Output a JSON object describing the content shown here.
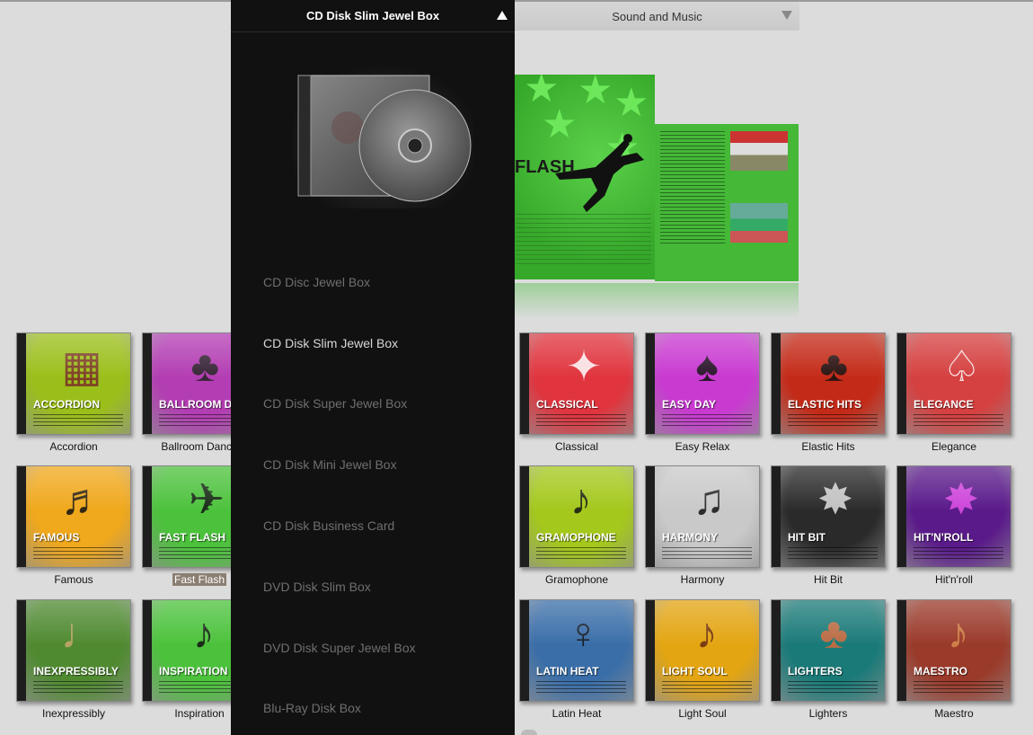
{
  "product_select": {
    "selected": "CD Disk Slim Jewel Box"
  },
  "category_select": {
    "selected": "Sound and Music"
  },
  "menu": [
    "CD Disc Jewel Box",
    "CD Disk Slim Jewel Box",
    "CD Disk Super Jewel Box",
    "CD Disk Mini Jewel Box",
    "CD Disk Business Card",
    "DVD Disk Slim Box",
    "DVD Disk Super Jewel Box",
    "Blu-Ray Disk Box"
  ],
  "menu_active_index": 1,
  "preview": {
    "front_title": "FLASH"
  },
  "templates": [
    {
      "name": "Accordion",
      "cover_title": "ACCORDION",
      "bg": "#9bbf1a",
      "accent": "#7a2a2a",
      "icon": "accordion-icon"
    },
    {
      "name": "Ballroom Dance",
      "cover_title": "BALLROOM DANCE",
      "bg": "#b33db3",
      "accent": "#222",
      "icon": "dancers-icon"
    },
    {
      "name": "Classical",
      "cover_title": "CLASSICAL",
      "bg": "#e0343e",
      "accent": "#fff",
      "icon": "ballerina-icon"
    },
    {
      "name": "Easy Relax",
      "cover_title": "EASY DAY",
      "bg": "#c93ad1",
      "accent": "#111",
      "icon": "yoga-icon"
    },
    {
      "name": "Elastic Hits",
      "cover_title": "ELASTIC HITS",
      "bg": "#c42a18",
      "accent": "#111",
      "icon": "dancers-icon"
    },
    {
      "name": "Elegance",
      "cover_title": "ELEGANCE",
      "bg": "#d54040",
      "accent": "#fff",
      "icon": "tango-icon"
    },
    {
      "name": "Famous",
      "cover_title": "FAMOUS",
      "bg": "#f0a81c",
      "accent": "#111",
      "icon": "piano-icon"
    },
    {
      "name": "Fast Flash",
      "cover_title": "FAST FLASH",
      "bg": "#4cc23c",
      "accent": "#111",
      "icon": "dancer-icon"
    },
    {
      "name": "Gramophone",
      "cover_title": "GRAMOPHONE",
      "bg": "#a4c81c",
      "accent": "#111",
      "icon": "gramophone-icon"
    },
    {
      "name": "Harmony",
      "cover_title": "HARMONY",
      "bg": "#c9c9c9",
      "accent": "#111",
      "icon": "notes-icon"
    },
    {
      "name": "Hit Bit",
      "cover_title": "HIT BIT",
      "bg": "#2a2a2a",
      "accent": "#ddd",
      "icon": "breakdancer-icon"
    },
    {
      "name": "Hit'n'roll",
      "cover_title": "HIT'N'ROLL",
      "bg": "#5a1a8a",
      "accent": "#e24de8",
      "icon": "breakdancer-icon"
    },
    {
      "name": "Inexpressibly",
      "cover_title": "INEXPRESSIBLY",
      "bg": "#4f8a30",
      "accent": "#c9a86a",
      "icon": "tuba-icon"
    },
    {
      "name": "Inspiration",
      "cover_title": "INSPIRATION",
      "bg": "#4cc23c",
      "accent": "#111",
      "icon": "horn-icon"
    },
    {
      "name": "Latin Heat",
      "cover_title": "LATIN HEAT",
      "bg": "#3a6ea8",
      "accent": "#111",
      "icon": "singer-icon"
    },
    {
      "name": "Light Soul",
      "cover_title": "LIGHT SOUL",
      "bg": "#e3a512",
      "accent": "#6a2a10",
      "icon": "violin-icon"
    },
    {
      "name": "Lighters",
      "cover_title": "LIGHTERS",
      "bg": "#1a7a78",
      "accent": "#d86a3a",
      "icon": "dancers-icon"
    },
    {
      "name": "Maestro",
      "cover_title": "MAESTRO",
      "bg": "#9a3a2a",
      "accent": "#d88a4a",
      "icon": "violin-icon"
    }
  ],
  "selected_template": "Fast Flash"
}
